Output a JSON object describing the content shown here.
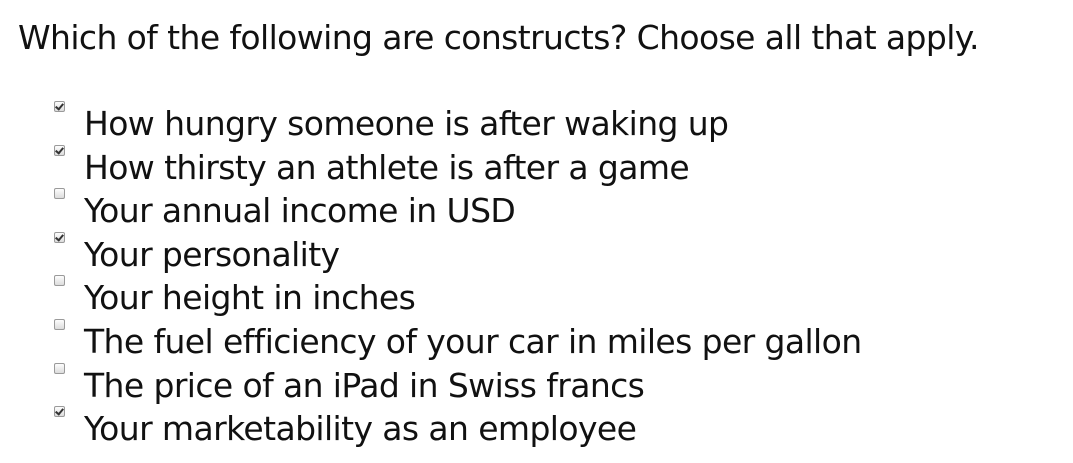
{
  "question": "Which of the following are constructs? Choose all that apply.",
  "options": [
    {
      "label": "How hungry someone is after waking up",
      "checked": true
    },
    {
      "label": "How thirsty an athlete is after a game",
      "checked": true
    },
    {
      "label": "Your annual income in USD",
      "checked": false
    },
    {
      "label": "Your personality",
      "checked": true
    },
    {
      "label": "Your height in inches",
      "checked": false
    },
    {
      "label": "The fuel efficiency of your car in miles per gallon",
      "checked": false
    },
    {
      "label": "The price of an iPad in Swiss francs",
      "checked": false
    },
    {
      "label": "Your marketability as an employee",
      "checked": true
    }
  ]
}
